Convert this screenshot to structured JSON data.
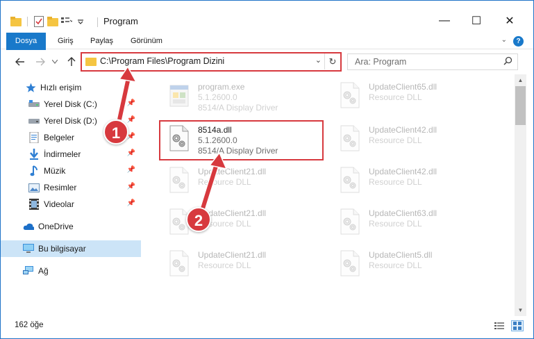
{
  "window": {
    "title": "Program",
    "controls": {
      "minimize": "—",
      "maximize": "☐",
      "close": "✕"
    }
  },
  "ribbon": {
    "tabs": [
      "Dosya",
      "Giriş",
      "Paylaş",
      "Görünüm"
    ],
    "help": "?"
  },
  "address_bar": {
    "path": "C:\\Program Files\\Program Dizini",
    "dropdown": "⌄",
    "refresh": "↻"
  },
  "search": {
    "placeholder": "Ara: Program"
  },
  "sidebar": {
    "items": [
      {
        "label": "Hızlı erişim",
        "icon": "star-icon",
        "pinned": false
      },
      {
        "label": "Yerel Disk (C:)",
        "icon": "drive-icon",
        "pinned": true
      },
      {
        "label": "Yerel Disk (D:)",
        "icon": "drive-icon",
        "pinned": true
      },
      {
        "label": "Belgeler",
        "icon": "documents-icon",
        "pinned": true
      },
      {
        "label": "İndirmeler",
        "icon": "download-icon",
        "pinned": true
      },
      {
        "label": "Müzik",
        "icon": "music-icon",
        "pinned": true
      },
      {
        "label": "Resimler",
        "icon": "pictures-icon",
        "pinned": true
      },
      {
        "label": "Videolar",
        "icon": "video-icon",
        "pinned": true
      },
      {
        "label": "OneDrive",
        "icon": "cloud-icon",
        "pinned": false
      },
      {
        "label": "Bu bilgisayar",
        "icon": "computer-icon",
        "pinned": false,
        "selected": true
      },
      {
        "label": "Ağ",
        "icon": "network-icon",
        "pinned": false
      }
    ]
  },
  "files": [
    {
      "name": "program.exe",
      "version": "5.1.2600.0",
      "description": "8514/A Display Driver",
      "type": "exe",
      "faded": true
    },
    {
      "name": "UpdateClient65.dll",
      "version": "",
      "description": "Resource DLL",
      "type": "dll",
      "faded": true
    },
    {
      "name": "8514a.dll",
      "version": "5.1.2600.0",
      "description": "8514/A Display Driver",
      "type": "dll",
      "faded": false,
      "highlighted": true
    },
    {
      "name": "UpdateClient42.dll",
      "version": "",
      "description": "Resource DLL",
      "type": "dll",
      "faded": true
    },
    {
      "name": "UpdateClient21.dll",
      "version": "",
      "description": "Resource DLL",
      "type": "dll",
      "faded": true
    },
    {
      "name": "UpdateClient42.dll",
      "version": "",
      "description": "Resource DLL",
      "type": "dll",
      "faded": true
    },
    {
      "name": "UpdateClient21.dll",
      "version": "",
      "description": "Resource DLL",
      "type": "dll",
      "faded": true
    },
    {
      "name": "UpdateClient63.dll",
      "version": "",
      "description": "Resource DLL",
      "type": "dll",
      "faded": true
    },
    {
      "name": "UpdateClient21.dll",
      "version": "",
      "description": "Resource DLL",
      "type": "dll",
      "faded": true
    },
    {
      "name": "UpdateClient5.dll",
      "version": "",
      "description": "Resource DLL",
      "type": "dll",
      "faded": true
    }
  ],
  "status": {
    "item_count": "162 öğe"
  },
  "callouts": [
    "1",
    "2"
  ],
  "colors": {
    "accent": "#1979ca",
    "highlight": "#d7393e",
    "selected": "#cce4f7"
  }
}
